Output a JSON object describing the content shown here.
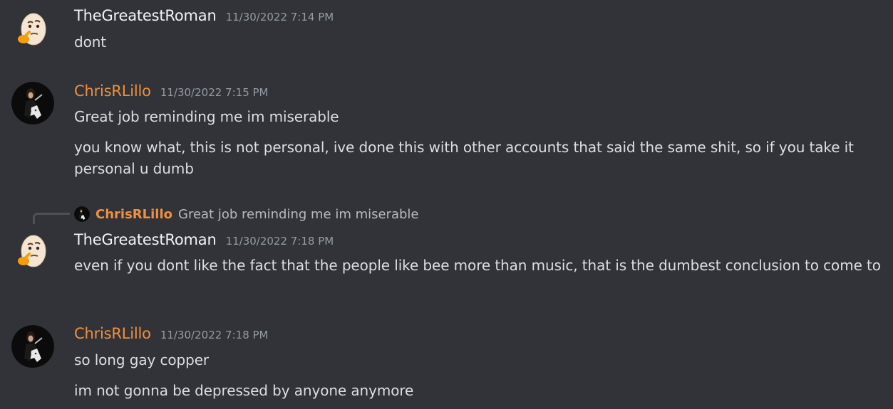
{
  "messages": [
    {
      "author": "TheGreatestRoman",
      "avatar_icon": "thinking-egg-icon",
      "timestamp": "11/30/2022 7:14 PM",
      "lines": [
        "dont"
      ]
    },
    {
      "author": "ChrisRLillo",
      "avatar_icon": "guitarist-avatar-icon",
      "timestamp": "11/30/2022 7:15 PM",
      "lines": [
        "Great job reminding me im miserable",
        "you know what, this is not personal, ive done this with other accounts that said the same shit, so if you take it personal u dumb"
      ]
    },
    {
      "reply_to": {
        "author": "ChrisRLillo",
        "text": "Great job reminding me im miserable"
      },
      "author": "TheGreatestRoman",
      "avatar_icon": "thinking-egg-icon",
      "timestamp": "11/30/2022 7:18 PM",
      "lines": [
        "even if you dont like the fact that the people like bee more than music, that is the dumbest conclusion to come to"
      ]
    },
    {
      "author": "ChrisRLillo",
      "avatar_icon": "guitarist-avatar-icon",
      "timestamp": "11/30/2022 7:18 PM",
      "lines": [
        "so long gay copper",
        "im not gonna be depressed by anyone anymore"
      ]
    }
  ],
  "colors": {
    "background": "#313338",
    "username_default": "#f2f3f5",
    "username_role": "#f28f3b",
    "timestamp": "#949ba4",
    "message_text": "#dbdee1"
  }
}
